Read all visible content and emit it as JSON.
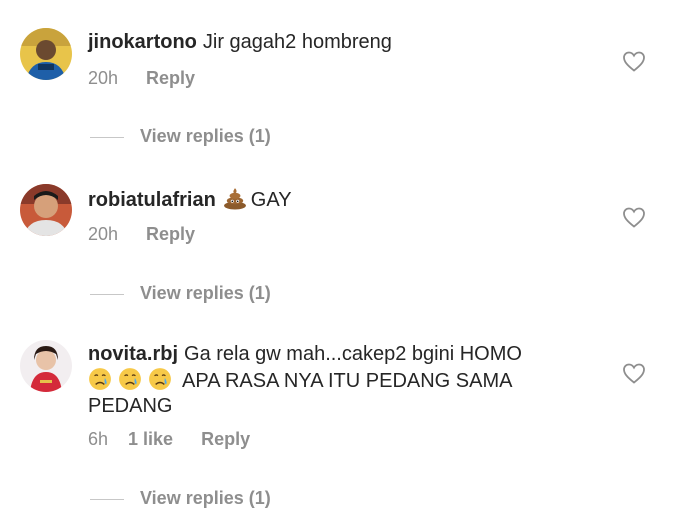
{
  "comments": [
    {
      "username": "jinokartono",
      "text": "Jir gagah2 hombreng",
      "time": "20h",
      "likes": "",
      "reply_label": "Reply",
      "view_replies": "View replies (1)"
    },
    {
      "username": "robiatulafrian",
      "emoji": "pile-of-poo",
      "text": "GAY",
      "time": "20h",
      "likes": "",
      "reply_label": "Reply",
      "view_replies": "View replies (1)"
    },
    {
      "username": "novita.rbj",
      "text_part1": "Ga rela gw mah...cakep2 bgini HOMO",
      "emojis": [
        "crying-face",
        "crying-face",
        "crying-face"
      ],
      "text_part2": "APA RASA NYA ITU PEDANG SAMA PEDANG",
      "time": "6h",
      "likes": "1 like",
      "reply_label": "Reply",
      "view_replies": "View replies (1)"
    }
  ],
  "colors": {
    "text": "#262626",
    "meta": "#8e8e8e",
    "divider": "#c7c7c7"
  }
}
